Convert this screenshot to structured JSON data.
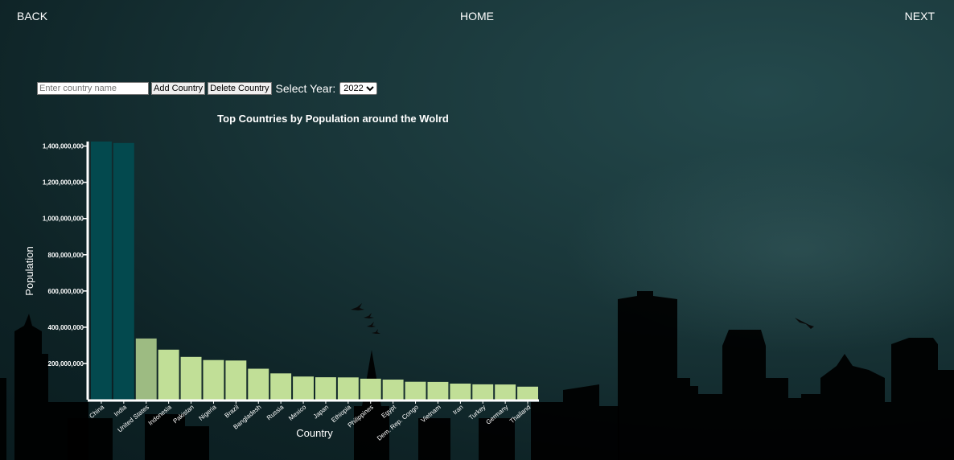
{
  "nav": {
    "back": "BACK",
    "home": "HOME",
    "next": "NEXT"
  },
  "controls": {
    "country_placeholder": "Enter country name",
    "add_label": "Add Country",
    "delete_label": "Delete Country",
    "year_label": "Select Year:",
    "year_selected": "2022"
  },
  "colors": {
    "top_bar": "#03494e",
    "other_bar": "#c1df97",
    "other_bar_first": "#9dbb82",
    "text": "#ffffff"
  },
  "chart_data": {
    "type": "bar",
    "title": "Top Countries by Population around the Wolrd",
    "xlabel": "Country",
    "ylabel": "Population",
    "ylim": [
      0,
      1425000000
    ],
    "yticks": [
      200000000,
      400000000,
      600000000,
      800000000,
      1000000000,
      1200000000,
      1400000000
    ],
    "ytick_labels": [
      "200,000,000",
      "400,000,000",
      "600,000,000",
      "800,000,000",
      "1,000,000,000",
      "1,200,000,000",
      "1,400,000,000"
    ],
    "categories": [
      "China",
      "India",
      "United States",
      "Indonesia",
      "Pakistan",
      "Nigeria",
      "Brazil",
      "Bangladesh",
      "Russia",
      "Mexico",
      "Japan",
      "Ethiopia",
      "Philippines",
      "Egypt",
      "Dem. Rep. Congo",
      "Vietnam",
      "Iran",
      "Turkey",
      "Germany",
      "Thailand"
    ],
    "values": [
      1425000000,
      1417000000,
      338000000,
      276000000,
      236000000,
      219000000,
      216000000,
      171000000,
      145000000,
      128000000,
      124000000,
      123000000,
      116000000,
      111000000,
      99000000,
      98000000,
      89000000,
      85000000,
      84000000,
      72000000
    ]
  }
}
